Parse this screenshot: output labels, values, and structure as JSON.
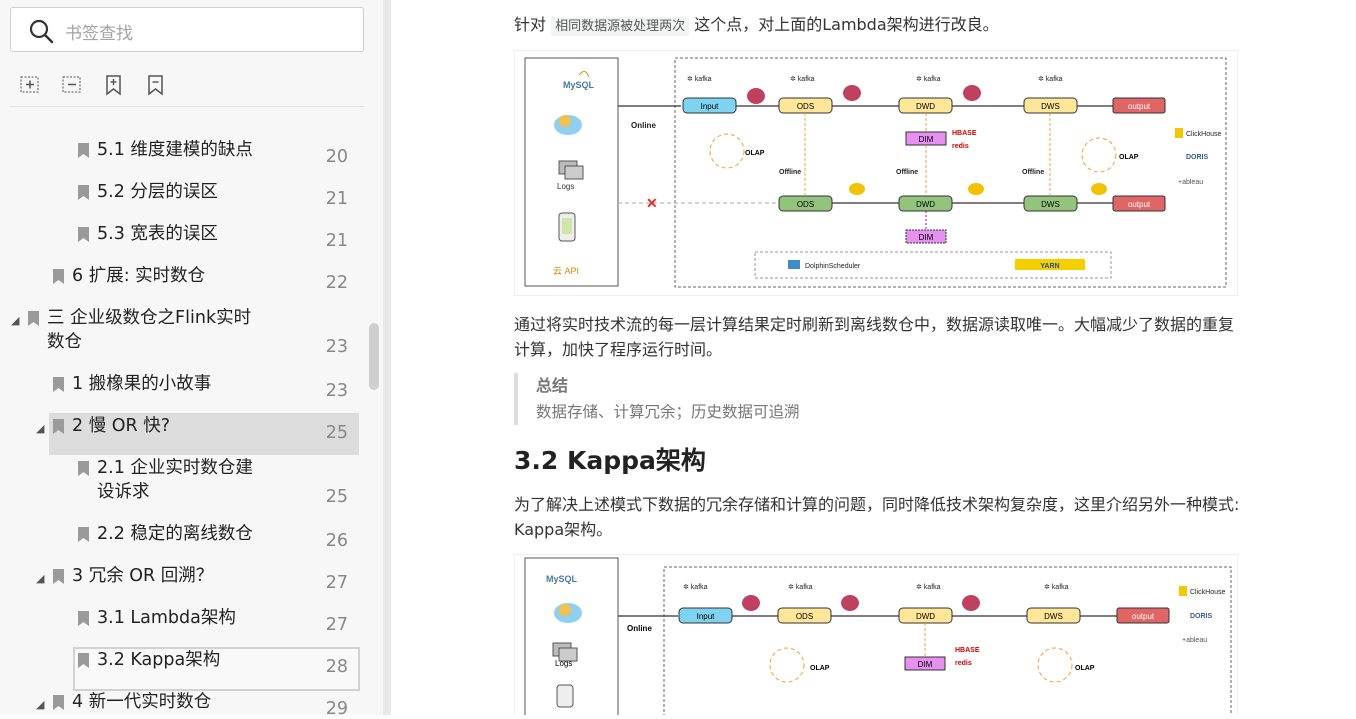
{
  "sidebar": {
    "search_placeholder": "书签查找",
    "tools": [
      "expand-all-icon",
      "collapse-all-icon",
      "add-bookmark-icon",
      "remove-bookmark-icon"
    ],
    "items": [
      {
        "label": "5.1 维度建模的缺点",
        "page": "20"
      },
      {
        "label": "5.2 分层的误区",
        "page": "21"
      },
      {
        "label": "5.3 宽表的误区",
        "page": "21"
      },
      {
        "label": "6 扩展: 实时数仓",
        "page": "22"
      },
      {
        "label": "三  企业级数仓之Flink实时",
        "label2": "数仓",
        "page": "23"
      },
      {
        "label": "1 搬橡果的小故事",
        "page": "23"
      },
      {
        "label": "2 慢 OR 快?",
        "page": "25"
      },
      {
        "label": "2.1 企业实时数仓建",
        "label2": "设诉求",
        "page": "25"
      },
      {
        "label": "2.2 稳定的离线数仓",
        "page": "26"
      },
      {
        "label": "3 冗余 OR 回溯？",
        "page": "27"
      },
      {
        "label": "3.1 Lambda架构",
        "page": "27"
      },
      {
        "label": "3.2 Kappa架构",
        "page": "28"
      },
      {
        "label": "4 新一代实时数仓",
        "page": "29"
      }
    ]
  },
  "content": {
    "para1_prefix": "针对",
    "para1_code": "相同数据源被处理两次",
    "para1_suffix": "这个点，对上面的Lambda架构进行改良。",
    "para2_line1": "通过将实时技术流的每一层计算结果定时刷新到离线数仓中，数据源读取唯一。大幅减少了数据的重复",
    "para2_line2": "计算，加快了程序运行时间。",
    "quote_title": "总结",
    "quote_body": "数据存储、计算冗余；历史数据可追溯",
    "heading": "3.2 Kappa架构",
    "para3_line1": "为了解决上述模式下数据的冗余存储和计算的问题，同时降低技术架构复杂度，这里介绍另外一种模式:",
    "para3_line2": "Kappa架构。"
  },
  "diagram1": {
    "sources": [
      "MySQL",
      "Logs",
      "云 API"
    ],
    "kafka": "kafka",
    "nodes_online": [
      "Input",
      "ODS",
      "DWD",
      "DWS",
      "output"
    ],
    "nodes_offline": [
      "ODS",
      "DWD",
      "DWS",
      "output"
    ],
    "dim": "DIM",
    "online": "Online",
    "offline": "Offline",
    "olap": "OLAP",
    "hbase": "HBASE",
    "redis": "redis",
    "olap_engines": [
      "ClickHouse",
      "DORIS",
      "+ableau"
    ],
    "scheduler": "DolphinScheduler",
    "yarn": "YARN"
  },
  "diagram2": {
    "sources": [
      "MySQL",
      "Logs"
    ],
    "nodes": [
      "Input",
      "ODS",
      "DWD",
      "DWS",
      "output"
    ],
    "dim": "DIM",
    "online": "Online",
    "olap": "OLAP"
  },
  "colors": {
    "input": "#7fd3f0",
    "ods": "#ffe699",
    "dwd": "#ffe699",
    "dws": "#ffe699",
    "output": "#e06666",
    "green": "#93c47d",
    "dim": "#e691f0"
  }
}
